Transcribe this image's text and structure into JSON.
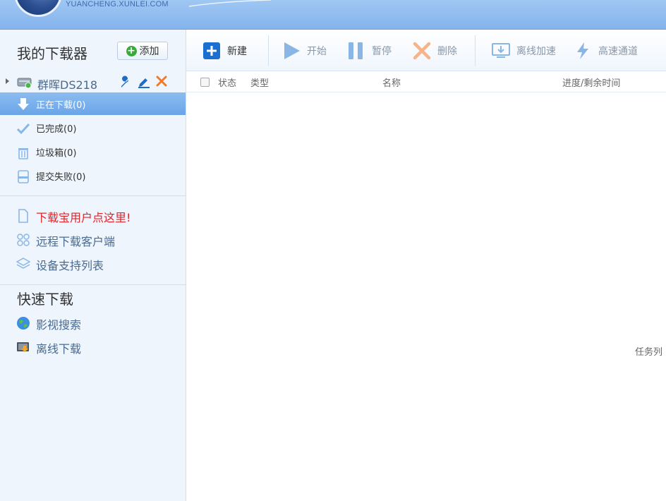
{
  "header": {
    "logo_text": "YUANCHENG.XUNLEI.COM"
  },
  "sidebar": {
    "title": "我的下载器",
    "add_label": "添加",
    "device": {
      "name": "群晖DS218"
    },
    "nav": [
      {
        "label": "正在下载(0)",
        "icon": "download-arrow-icon",
        "active": true
      },
      {
        "label": "已完成(0)",
        "icon": "check-icon",
        "active": false
      },
      {
        "label": "垃圾箱(0)",
        "icon": "trash-icon",
        "active": false
      },
      {
        "label": "提交失败(0)",
        "icon": "failed-document-icon",
        "active": false
      }
    ],
    "links": [
      {
        "label": "下载宝用户点这里!",
        "icon": "document-icon"
      },
      {
        "label": "远程下载客户端",
        "icon": "client-grid-icon"
      },
      {
        "label": "设备支持列表",
        "icon": "layers-icon"
      }
    ],
    "quick_title": "快速下载",
    "quick_links": [
      {
        "label": "影视搜索",
        "icon": "globe-icon"
      },
      {
        "label": "离线下载",
        "icon": "offline-download-icon"
      }
    ]
  },
  "toolbar": {
    "new_label": "新建",
    "start_label": "开始",
    "pause_label": "暂停",
    "delete_label": "删除",
    "offline_label": "离线加速",
    "highspeed_label": "高速通道"
  },
  "table": {
    "columns": {
      "status": "状态",
      "type": "类型",
      "name": "名称",
      "progress": "进度/剩余时间"
    },
    "empty_hint": "任务列"
  },
  "colors": {
    "accent": "#1a6fd0",
    "active_nav": "#7ab0ec",
    "red_link": "#e0252b",
    "disabled": "#8ab6e6"
  }
}
